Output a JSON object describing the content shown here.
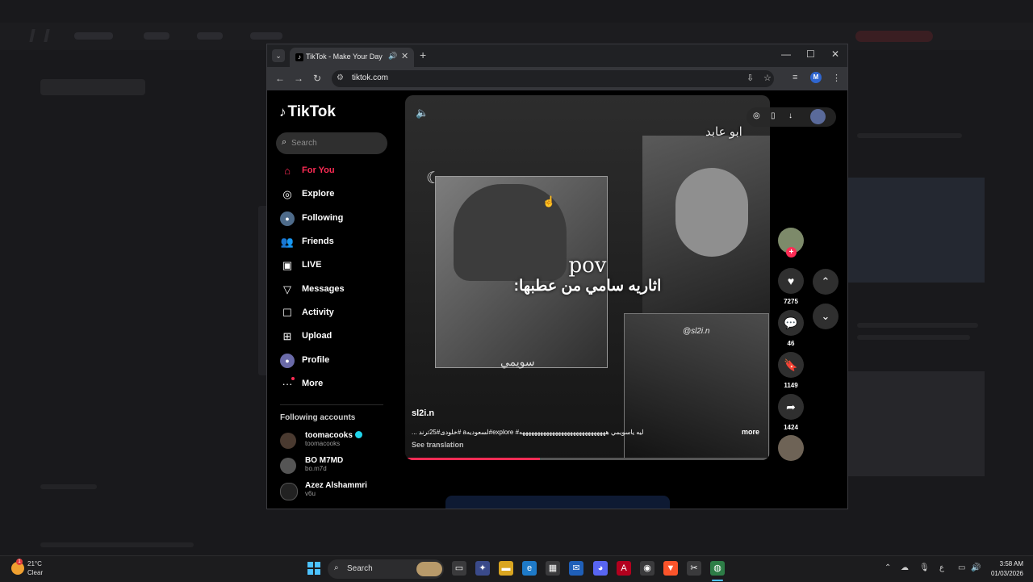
{
  "colors": {
    "accent": "#fe2c55",
    "verified": "#20d5ec",
    "taskbar_accent": "#4cc2ff"
  },
  "browser": {
    "tab_title": "TikTok - Make Your Day",
    "url": "tiktok.com",
    "profile_initial": "M"
  },
  "tiktok": {
    "brand": "TikTok",
    "search_placeholder": "Search",
    "nav": [
      {
        "label": "For You",
        "icon": "home-icon",
        "active": true
      },
      {
        "label": "Explore",
        "icon": "compass-icon"
      },
      {
        "label": "Following",
        "icon": "following-avatar-icon"
      },
      {
        "label": "Friends",
        "icon": "friends-icon"
      },
      {
        "label": "LIVE",
        "icon": "live-icon"
      },
      {
        "label": "Messages",
        "icon": "messages-icon"
      },
      {
        "label": "Activity",
        "icon": "activity-icon"
      },
      {
        "label": "Upload",
        "icon": "upload-icon"
      },
      {
        "label": "Profile",
        "icon": "profile-avatar-icon"
      },
      {
        "label": "More",
        "icon": "more-icon"
      }
    ],
    "following_title": "Following accounts",
    "accounts": [
      {
        "name": "toomacooks",
        "handle": "toomacooks",
        "verified": true
      },
      {
        "name": "BO M7MD",
        "handle": "bo.m7d"
      },
      {
        "name": "Azez Alshammri",
        "handle": "v6u"
      }
    ],
    "video": {
      "overlay_title": "pov",
      "overlay_text": "اثاريه سامي من عطبها:",
      "watermark_top": "ابو عابد",
      "watermark_bottom": "سويمي",
      "watermark_handle": "@sl2i.n",
      "author": "sl2i.n",
      "caption": "... خلودى#25ترند# aلسعوديه#explore #ليه ياسويمي هههههههههههههههههههههههههههههه",
      "more": "more",
      "see_translation": "See translation",
      "progress": 0.37
    },
    "actions": {
      "likes": "7275",
      "comments": "46",
      "saves": "1149",
      "shares": "1424"
    }
  },
  "taskbar": {
    "temp": "21°C",
    "condition": "Clear",
    "weather_badge": "1",
    "search": "Search",
    "tray_lang": "ع",
    "time": "3:58 AM",
    "date": "01/03/2026"
  }
}
